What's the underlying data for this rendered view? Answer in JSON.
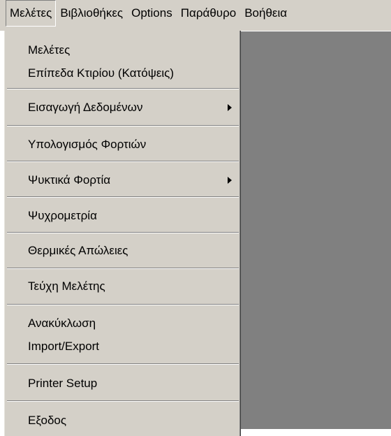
{
  "menubar": {
    "items": [
      {
        "label": "Μελέτες",
        "active": true
      },
      {
        "label": "Βιβλιοθήκες"
      },
      {
        "label": "Options"
      },
      {
        "label": "Παράθυρο"
      },
      {
        "label": "Βοήθεια"
      }
    ]
  },
  "dropdown": {
    "items": [
      {
        "label": "Μελέτες"
      },
      {
        "label": "Επίπεδα Κτιρίου (Κατόψεις)"
      },
      {
        "label": "Εισαγωγή Δεδομένων",
        "submenu": true
      },
      {
        "label": "Υπολογισμός Φορτιών"
      },
      {
        "label": "Ψυκτικά Φορτία",
        "submenu": true
      },
      {
        "label": "Ψυχρομετρία"
      },
      {
        "label": "Θερμικές Απώλειες"
      },
      {
        "label": "Τεύχη Μελέτης"
      },
      {
        "label": "Ανακύκλωση"
      },
      {
        "label": "Import/Export"
      },
      {
        "label": "Printer Setup"
      },
      {
        "label": "Εξοδος"
      }
    ]
  }
}
